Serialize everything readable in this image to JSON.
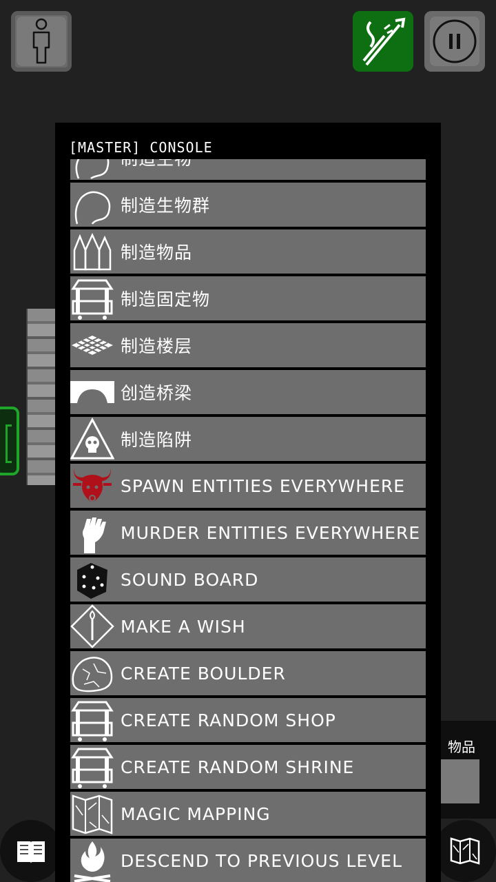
{
  "console": {
    "title": "[MASTER] CONSOLE",
    "items": [
      {
        "label": "制造生物",
        "icon": "head-icon"
      },
      {
        "label": "制造生物群",
        "icon": "head-icon"
      },
      {
        "label": "制造物品",
        "icon": "items-icon"
      },
      {
        "label": "制造固定物",
        "icon": "stall-icon"
      },
      {
        "label": "制造楼层",
        "icon": "floor-tiles-icon"
      },
      {
        "label": "创造桥梁",
        "icon": "bridge-icon"
      },
      {
        "label": "制造陷阱",
        "icon": "trap-skull-icon"
      },
      {
        "label": "SPAWN ENTITIES EVERYWHERE",
        "icon": "bull-head-icon"
      },
      {
        "label": "MURDER ENTITIES EVERYWHERE",
        "icon": "fist-icon"
      },
      {
        "label": "SOUND BOARD",
        "icon": "dice-icon"
      },
      {
        "label": "MAKE A WISH",
        "icon": "wand-icon"
      },
      {
        "label": "CREATE BOULDER",
        "icon": "boulder-icon"
      },
      {
        "label": "CREATE RANDOM SHOP",
        "icon": "shop-icon"
      },
      {
        "label": "CREATE RANDOM SHRINE",
        "icon": "shrine-icon"
      },
      {
        "label": "MAGIC MAPPING",
        "icon": "map-icon"
      },
      {
        "label": "DESCEND TO PREVIOUS LEVEL",
        "icon": "campfire-icon"
      }
    ]
  },
  "side_panel": {
    "label": "物品"
  },
  "colors": {
    "ranged_button": "#0d6e12",
    "menu_item_bg": "#6e6e6e",
    "bull_red": "#b0101a"
  }
}
